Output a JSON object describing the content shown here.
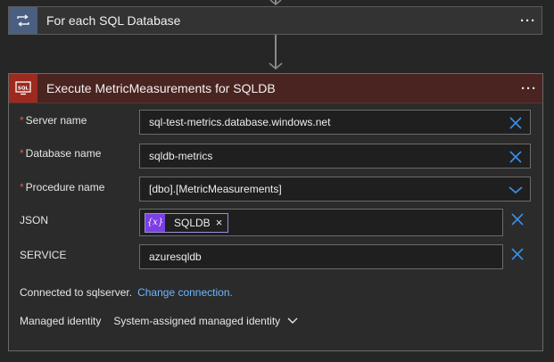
{
  "foreach": {
    "title": "For each SQL Database",
    "more": "···"
  },
  "action": {
    "title": "Execute MetricMeasurements for SQLDB",
    "more": "···",
    "fields": {
      "server": {
        "label": "Server name",
        "required": "*",
        "value": "sql-test-metrics.database.windows.net"
      },
      "database": {
        "label": "Database name",
        "required": "*",
        "value": "sqldb-metrics"
      },
      "procedure": {
        "label": "Procedure name",
        "required": "*",
        "value": "[dbo].[MetricMeasurements]"
      },
      "json": {
        "label": "JSON",
        "token_icon": "{x}",
        "token_label": "SQLDB",
        "token_remove": "×"
      },
      "service": {
        "label": "SERVICE",
        "value": "azuresqldb"
      }
    },
    "connection": {
      "text": "Connected to sqlserver.",
      "link": "Change connection."
    },
    "identity": {
      "label": "Managed identity",
      "value": "System-assigned managed identity"
    }
  },
  "colors": {
    "accent_blue": "#3b8fe6",
    "link_blue": "#6cb6ff",
    "sql_red": "#9d2a1e",
    "foreach_blue": "#4a5f80",
    "token_purple": "#7b3fe4"
  }
}
